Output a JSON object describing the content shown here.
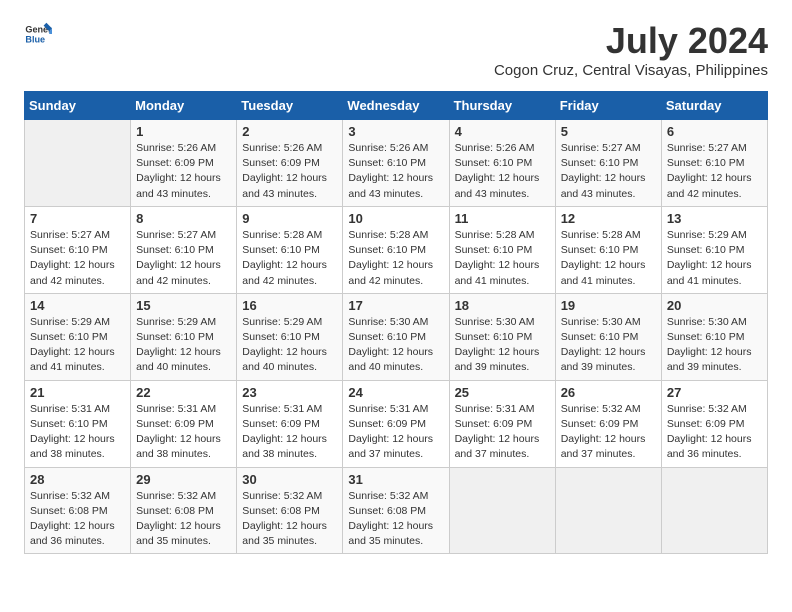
{
  "logo": {
    "text_general": "General",
    "text_blue": "Blue"
  },
  "title": "July 2024",
  "subtitle": "Cogon Cruz, Central Visayas, Philippines",
  "days_of_week": [
    "Sunday",
    "Monday",
    "Tuesday",
    "Wednesday",
    "Thursday",
    "Friday",
    "Saturday"
  ],
  "weeks": [
    [
      {
        "day": "",
        "sunrise": "",
        "sunset": "",
        "daylight": ""
      },
      {
        "day": "1",
        "sunrise": "5:26 AM",
        "sunset": "6:09 PM",
        "daylight": "12 hours and 43 minutes."
      },
      {
        "day": "2",
        "sunrise": "5:26 AM",
        "sunset": "6:09 PM",
        "daylight": "12 hours and 43 minutes."
      },
      {
        "day": "3",
        "sunrise": "5:26 AM",
        "sunset": "6:10 PM",
        "daylight": "12 hours and 43 minutes."
      },
      {
        "day": "4",
        "sunrise": "5:26 AM",
        "sunset": "6:10 PM",
        "daylight": "12 hours and 43 minutes."
      },
      {
        "day": "5",
        "sunrise": "5:27 AM",
        "sunset": "6:10 PM",
        "daylight": "12 hours and 43 minutes."
      },
      {
        "day": "6",
        "sunrise": "5:27 AM",
        "sunset": "6:10 PM",
        "daylight": "12 hours and 42 minutes."
      }
    ],
    [
      {
        "day": "7",
        "sunrise": "5:27 AM",
        "sunset": "6:10 PM",
        "daylight": "12 hours and 42 minutes."
      },
      {
        "day": "8",
        "sunrise": "5:27 AM",
        "sunset": "6:10 PM",
        "daylight": "12 hours and 42 minutes."
      },
      {
        "day": "9",
        "sunrise": "5:28 AM",
        "sunset": "6:10 PM",
        "daylight": "12 hours and 42 minutes."
      },
      {
        "day": "10",
        "sunrise": "5:28 AM",
        "sunset": "6:10 PM",
        "daylight": "12 hours and 42 minutes."
      },
      {
        "day": "11",
        "sunrise": "5:28 AM",
        "sunset": "6:10 PM",
        "daylight": "12 hours and 41 minutes."
      },
      {
        "day": "12",
        "sunrise": "5:28 AM",
        "sunset": "6:10 PM",
        "daylight": "12 hours and 41 minutes."
      },
      {
        "day": "13",
        "sunrise": "5:29 AM",
        "sunset": "6:10 PM",
        "daylight": "12 hours and 41 minutes."
      }
    ],
    [
      {
        "day": "14",
        "sunrise": "5:29 AM",
        "sunset": "6:10 PM",
        "daylight": "12 hours and 41 minutes."
      },
      {
        "day": "15",
        "sunrise": "5:29 AM",
        "sunset": "6:10 PM",
        "daylight": "12 hours and 40 minutes."
      },
      {
        "day": "16",
        "sunrise": "5:29 AM",
        "sunset": "6:10 PM",
        "daylight": "12 hours and 40 minutes."
      },
      {
        "day": "17",
        "sunrise": "5:30 AM",
        "sunset": "6:10 PM",
        "daylight": "12 hours and 40 minutes."
      },
      {
        "day": "18",
        "sunrise": "5:30 AM",
        "sunset": "6:10 PM",
        "daylight": "12 hours and 39 minutes."
      },
      {
        "day": "19",
        "sunrise": "5:30 AM",
        "sunset": "6:10 PM",
        "daylight": "12 hours and 39 minutes."
      },
      {
        "day": "20",
        "sunrise": "5:30 AM",
        "sunset": "6:10 PM",
        "daylight": "12 hours and 39 minutes."
      }
    ],
    [
      {
        "day": "21",
        "sunrise": "5:31 AM",
        "sunset": "6:10 PM",
        "daylight": "12 hours and 38 minutes."
      },
      {
        "day": "22",
        "sunrise": "5:31 AM",
        "sunset": "6:09 PM",
        "daylight": "12 hours and 38 minutes."
      },
      {
        "day": "23",
        "sunrise": "5:31 AM",
        "sunset": "6:09 PM",
        "daylight": "12 hours and 38 minutes."
      },
      {
        "day": "24",
        "sunrise": "5:31 AM",
        "sunset": "6:09 PM",
        "daylight": "12 hours and 37 minutes."
      },
      {
        "day": "25",
        "sunrise": "5:31 AM",
        "sunset": "6:09 PM",
        "daylight": "12 hours and 37 minutes."
      },
      {
        "day": "26",
        "sunrise": "5:32 AM",
        "sunset": "6:09 PM",
        "daylight": "12 hours and 37 minutes."
      },
      {
        "day": "27",
        "sunrise": "5:32 AM",
        "sunset": "6:09 PM",
        "daylight": "12 hours and 36 minutes."
      }
    ],
    [
      {
        "day": "28",
        "sunrise": "5:32 AM",
        "sunset": "6:08 PM",
        "daylight": "12 hours and 36 minutes."
      },
      {
        "day": "29",
        "sunrise": "5:32 AM",
        "sunset": "6:08 PM",
        "daylight": "12 hours and 35 minutes."
      },
      {
        "day": "30",
        "sunrise": "5:32 AM",
        "sunset": "6:08 PM",
        "daylight": "12 hours and 35 minutes."
      },
      {
        "day": "31",
        "sunrise": "5:32 AM",
        "sunset": "6:08 PM",
        "daylight": "12 hours and 35 minutes."
      },
      {
        "day": "",
        "sunrise": "",
        "sunset": "",
        "daylight": ""
      },
      {
        "day": "",
        "sunrise": "",
        "sunset": "",
        "daylight": ""
      },
      {
        "day": "",
        "sunrise": "",
        "sunset": "",
        "daylight": ""
      }
    ]
  ]
}
